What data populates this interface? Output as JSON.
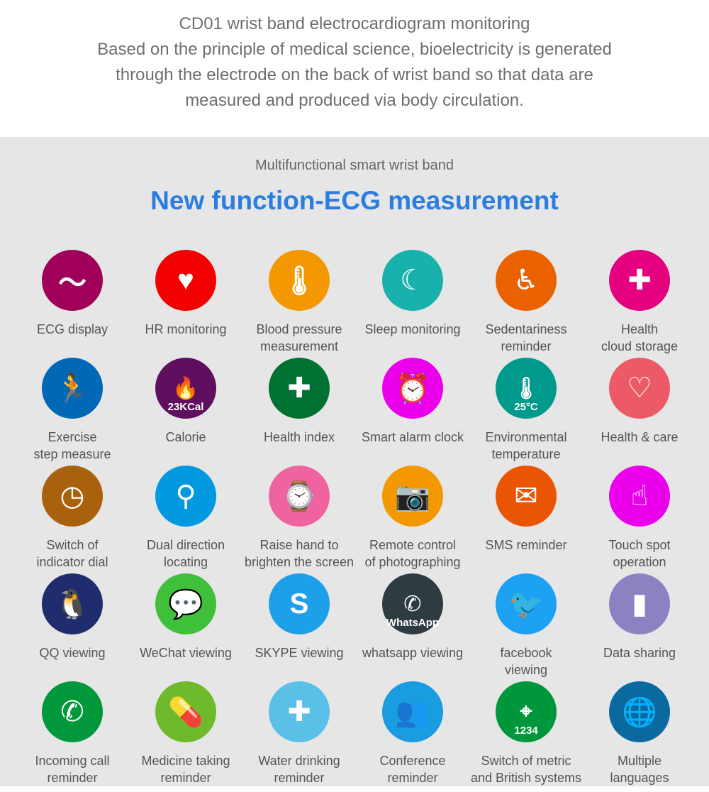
{
  "intro": {
    "line1": "CD01 wrist band electrocardiogram monitoring",
    "line2": "Based on the principle of medical science, bioelectricity is generated",
    "line3": "through the electrode on the back of wrist band so that data are",
    "line4": "measured and produced via body circulation."
  },
  "subtitle": "Multifunctional smart wrist band",
  "title": "New function-ECG measurement",
  "features": [
    {
      "label": "ECG display",
      "icon": "ecg-wave-icon",
      "color": "#a0005a",
      "glyph": "〜"
    },
    {
      "label": "HR monitoring",
      "icon": "heart-rate-icon",
      "color": "#f20000",
      "glyph": "♥"
    },
    {
      "label": "Blood pressure\nmeasurement",
      "icon": "thermometer-icon",
      "color": "#f39800",
      "glyph": "🌡"
    },
    {
      "label": "Sleep monitoring",
      "icon": "moon-icon",
      "color": "#19b1ac",
      "glyph": "☾"
    },
    {
      "label": "Sedentariness\nreminder",
      "icon": "seated-person-icon",
      "color": "#ea6100",
      "glyph": "♿"
    },
    {
      "label": "Health\ncloud storage",
      "icon": "hands-plus-icon",
      "color": "#e4007f",
      "glyph": "✚"
    },
    {
      "label": "Exercise\nstep measure",
      "icon": "runner-icon",
      "color": "#0068b7",
      "glyph": "🏃"
    },
    {
      "label": "Calorie",
      "icon": "flame-icon",
      "color": "#5e0f5e",
      "glyph": "🔥",
      "badge": "23KCal"
    },
    {
      "label": "Health index",
      "icon": "heart-plus-icon",
      "color": "#007130",
      "glyph": "✚"
    },
    {
      "label": "Smart alarm clock",
      "icon": "alarm-clock-icon",
      "color": "#ea00ea",
      "glyph": "⏰"
    },
    {
      "label": "Environmental\ntemperature",
      "icon": "thermometer-icon",
      "color": "#009a8c",
      "glyph": "🌡",
      "badge": "25°C"
    },
    {
      "label": "Health & care",
      "icon": "family-icon",
      "color": "#ec5a68",
      "glyph": "♡"
    },
    {
      "label": "Switch of\nindicator dial",
      "icon": "watch-dial-icon",
      "color": "#a8620e",
      "glyph": "◷"
    },
    {
      "label": "Dual direction\nlocating",
      "icon": "magnifier-icon",
      "color": "#0399e0",
      "glyph": "⚲"
    },
    {
      "label": "Raise hand to\nbrighten the screen",
      "icon": "watch-icon",
      "color": "#ee63a0",
      "glyph": "⌚"
    },
    {
      "label": "Remote control\nof photographing",
      "icon": "camera-icon",
      "color": "#f39800",
      "glyph": "📷"
    },
    {
      "label": "SMS reminder",
      "icon": "envelope-icon",
      "color": "#ea5504",
      "glyph": "✉"
    },
    {
      "label": "Touch spot\noperation",
      "icon": "touch-tablet-icon",
      "color": "#ea00ea",
      "glyph": "☝"
    },
    {
      "label": "QQ viewing",
      "icon": "qq-penguin-icon",
      "color": "#1f2d6e",
      "glyph": "🐧"
    },
    {
      "label": "WeChat viewing",
      "icon": "wechat-icon",
      "color": "#3fbf3a",
      "glyph": "💬"
    },
    {
      "label": "SKYPE viewing",
      "icon": "skype-icon",
      "color": "#1ea0e8",
      "glyph": "S"
    },
    {
      "label": "whatsapp viewing",
      "icon": "whatsapp-icon",
      "color": "#2e3c42",
      "glyph": "✆",
      "badge": "WhatsApp"
    },
    {
      "label": "facebook\nviewing",
      "icon": "bird-icon",
      "color": "#1da1f2",
      "glyph": "🐦"
    },
    {
      "label": "Data sharing",
      "icon": "bar-chart-icon",
      "color": "#8c82c2",
      "glyph": "▮"
    },
    {
      "label": "Incoming call\nreminder",
      "icon": "phone-icon",
      "color": "#00983a",
      "glyph": "✆"
    },
    {
      "label": "Medicine taking\nreminder",
      "icon": "pill-icon",
      "color": "#6fb92c",
      "glyph": "💊"
    },
    {
      "label": "Water drinking\nreminder",
      "icon": "water-glass-icon",
      "color": "#5ac0e8",
      "glyph": "✚"
    },
    {
      "label": "Conference\nreminder",
      "icon": "meeting-icon",
      "color": "#1a9ce0",
      "glyph": "👥"
    },
    {
      "label": "Switch of metric\nand British systems",
      "icon": "map-pins-icon",
      "color": "#00973c",
      "glyph": "⌖",
      "badge": "1234"
    },
    {
      "label": "Multiple\nlanguages",
      "icon": "globe-icon",
      "color": "#0a6aa0",
      "glyph": "🌐"
    }
  ]
}
